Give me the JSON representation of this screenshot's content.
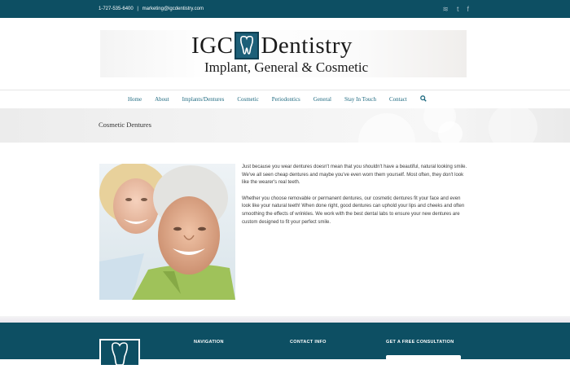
{
  "topbar": {
    "phone": "1-727-535-6400",
    "separator": "|",
    "email": "marketing@igcdentistry.com",
    "social_icons": [
      "rss-icon",
      "twitter-icon",
      "facebook-icon"
    ],
    "social_glyphs": [
      "≋",
      "t",
      "f"
    ]
  },
  "logo": {
    "left": "IGC",
    "right": "Dentistry",
    "tagline": "Implant, General & Cosmetic"
  },
  "nav": {
    "items": [
      "Home",
      "About",
      "Implants/Dentures",
      "Cosmetic",
      "Periodontics",
      "General",
      "Stay In Touch",
      "Contact"
    ],
    "search_icon": "search-icon"
  },
  "page": {
    "title": "Cosmetic Dentures",
    "paragraphs": [
      "Just because you wear dentures doesn't mean that you shouldn't have a beautiful, natural looking smile. We've all seen cheap dentures and maybe you've even worn them yourself. Most often, they don't look like the wearer's real teeth.",
      "Whether you choose removable or permanent dentures, our cosmetic dentures fit your face and even look like your natural teeth! When done right, good dentures can uphold your lips and cheeks and often smoothing the effects of wrinkles. We work with the best dental labs to ensure your new dentures are custom designed to fit your perfect smile."
    ]
  },
  "footer": {
    "navigation": "NAVIGATION",
    "contact_info": "CONTACT INFO",
    "consultation": "GET A FREE CONSULTATION"
  },
  "colors": {
    "brand_teal": "#0d4f63",
    "nav_link": "#1f6a80"
  }
}
